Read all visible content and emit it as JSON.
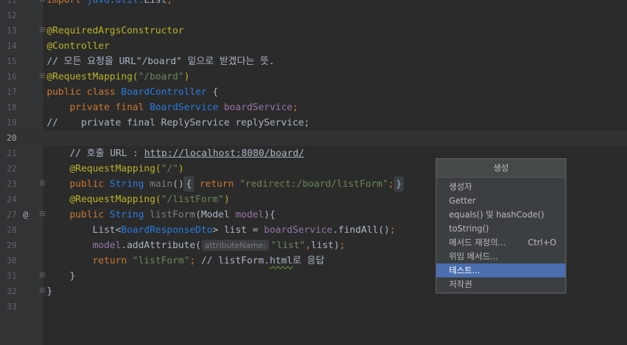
{
  "lines": [
    {
      "num": "11",
      "segs": [
        {
          "c": "kw",
          "t": "import "
        },
        {
          "c": "cls",
          "t": "java.util."
        },
        {
          "c": "fn",
          "t": "List"
        },
        {
          "c": "kw",
          "t": ";"
        }
      ]
    },
    {
      "num": "12",
      "segs": []
    },
    {
      "num": "13",
      "segs": [
        {
          "c": "ann",
          "t": "@RequiredArgsConstructor"
        }
      ]
    },
    {
      "num": "14",
      "segs": [
        {
          "c": "ann",
          "t": "@Controller"
        }
      ]
    },
    {
      "num": "15",
      "segs": [
        {
          "c": "cmt",
          "t": "// 모든 요청을 URL\"/board\" 밑으로 받겠다는 뜻."
        }
      ]
    },
    {
      "num": "16",
      "segs": [
        {
          "c": "ann",
          "t": "@RequestMapping("
        },
        {
          "c": "str",
          "t": "\"/board\""
        },
        {
          "c": "ann",
          "t": ")"
        }
      ]
    },
    {
      "num": "17",
      "segs": [
        {
          "c": "kw",
          "t": "public class "
        },
        {
          "c": "cls",
          "t": "BoardController "
        },
        {
          "c": "fn",
          "t": "{"
        }
      ]
    },
    {
      "num": "18",
      "segs": [
        {
          "c": "kw",
          "t": "    private final "
        },
        {
          "c": "cls",
          "t": "BoardService "
        },
        {
          "c": "fld",
          "t": "boardService"
        },
        {
          "c": "kw",
          "t": ";"
        }
      ]
    },
    {
      "num": "19",
      "segs": [
        {
          "c": "cmt",
          "t": "//    private final ReplyService replyService;"
        }
      ]
    },
    {
      "num": "20",
      "segs": []
    },
    {
      "num": "21",
      "segs": [
        {
          "c": "cmt",
          "t": "    // 호출 URL : "
        },
        {
          "c": "link",
          "t": "http://localhost:8080/board/"
        }
      ]
    },
    {
      "num": "22",
      "segs": [
        {
          "c": "ann",
          "t": "    @RequestMapping("
        },
        {
          "c": "str",
          "t": "\"/\""
        },
        {
          "c": "ann",
          "t": ")"
        }
      ]
    },
    {
      "num": "23",
      "segs": [
        {
          "c": "kw",
          "t": "    public "
        },
        {
          "c": "cls",
          "t": "String "
        },
        {
          "c": "dim",
          "t": "main"
        },
        {
          "c": "fn",
          "t": "()"
        },
        {
          "c": "brk",
          "t": "{"
        },
        {
          "c": "kw",
          "t": " return "
        },
        {
          "c": "str",
          "t": "\"redirect:/board/listForm\""
        },
        {
          "c": "kw",
          "t": ";"
        },
        {
          "c": "brk",
          "t": "}"
        }
      ]
    },
    {
      "num": "24",
      "segs": [
        {
          "c": "ann",
          "t": "    @RequestMapping("
        },
        {
          "c": "str",
          "t": "\"/listForm\""
        },
        {
          "c": "ann",
          "t": ")"
        }
      ]
    },
    {
      "num": "27",
      "segs": [
        {
          "c": "kw",
          "t": "    public "
        },
        {
          "c": "cls",
          "t": "String "
        },
        {
          "c": "dim",
          "t": "listForm"
        },
        {
          "c": "fn",
          "t": "(Model "
        },
        {
          "c": "fld",
          "t": "model"
        },
        {
          "c": "fn",
          "t": "){"
        }
      ]
    },
    {
      "num": "28",
      "segs": [
        {
          "c": "fn",
          "t": "        List<"
        },
        {
          "c": "cls",
          "t": "BoardResponseDto"
        },
        {
          "c": "fn",
          "t": "> list = "
        },
        {
          "c": "fld",
          "t": "boardService"
        },
        {
          "c": "fn",
          "t": ".findAll()"
        },
        {
          "c": "kw",
          "t": ";"
        }
      ]
    },
    {
      "num": "29",
      "segs": [
        {
          "c": "fld",
          "t": "        model"
        },
        {
          "c": "fn",
          "t": ".addAttribute("
        },
        {
          "c": "hint",
          "t": "attributeName:"
        },
        {
          "c": "str",
          "t": "\"list\""
        },
        {
          "c": "kw",
          "t": ","
        },
        {
          "c": "fn",
          "t": "list)"
        },
        {
          "c": "kw",
          "t": ";"
        }
      ]
    },
    {
      "num": "30",
      "segs": [
        {
          "c": "kw",
          "t": "        return "
        },
        {
          "c": "str",
          "t": "\"listForm\""
        },
        {
          "c": "kw",
          "t": "; "
        },
        {
          "c": "cmt",
          "t": "// listForm."
        },
        {
          "c": "warn",
          "t": "html"
        },
        {
          "c": "cmt",
          "t": "로 응답"
        }
      ]
    },
    {
      "num": "31",
      "segs": [
        {
          "c": "fn",
          "t": "    }"
        }
      ]
    },
    {
      "num": "32",
      "segs": [
        {
          "c": "fn",
          "t": "}"
        }
      ]
    },
    {
      "num": "33",
      "segs": []
    }
  ],
  "gutter_at_icon": "@",
  "popup": {
    "title": "생성",
    "items": [
      {
        "label": "생성자",
        "shortcut": ""
      },
      {
        "label": "Getter",
        "shortcut": ""
      },
      {
        "label": "equals() 및 hashCode()",
        "shortcut": ""
      },
      {
        "label": "toString()",
        "shortcut": ""
      },
      {
        "label": "메서드 재정의...",
        "shortcut": "Ctrl+O"
      },
      {
        "label": "위임 메서드...",
        "shortcut": ""
      },
      {
        "label": "테스트...",
        "shortcut": ""
      },
      {
        "label": "저작권",
        "shortcut": ""
      }
    ],
    "selected_index": 6
  }
}
